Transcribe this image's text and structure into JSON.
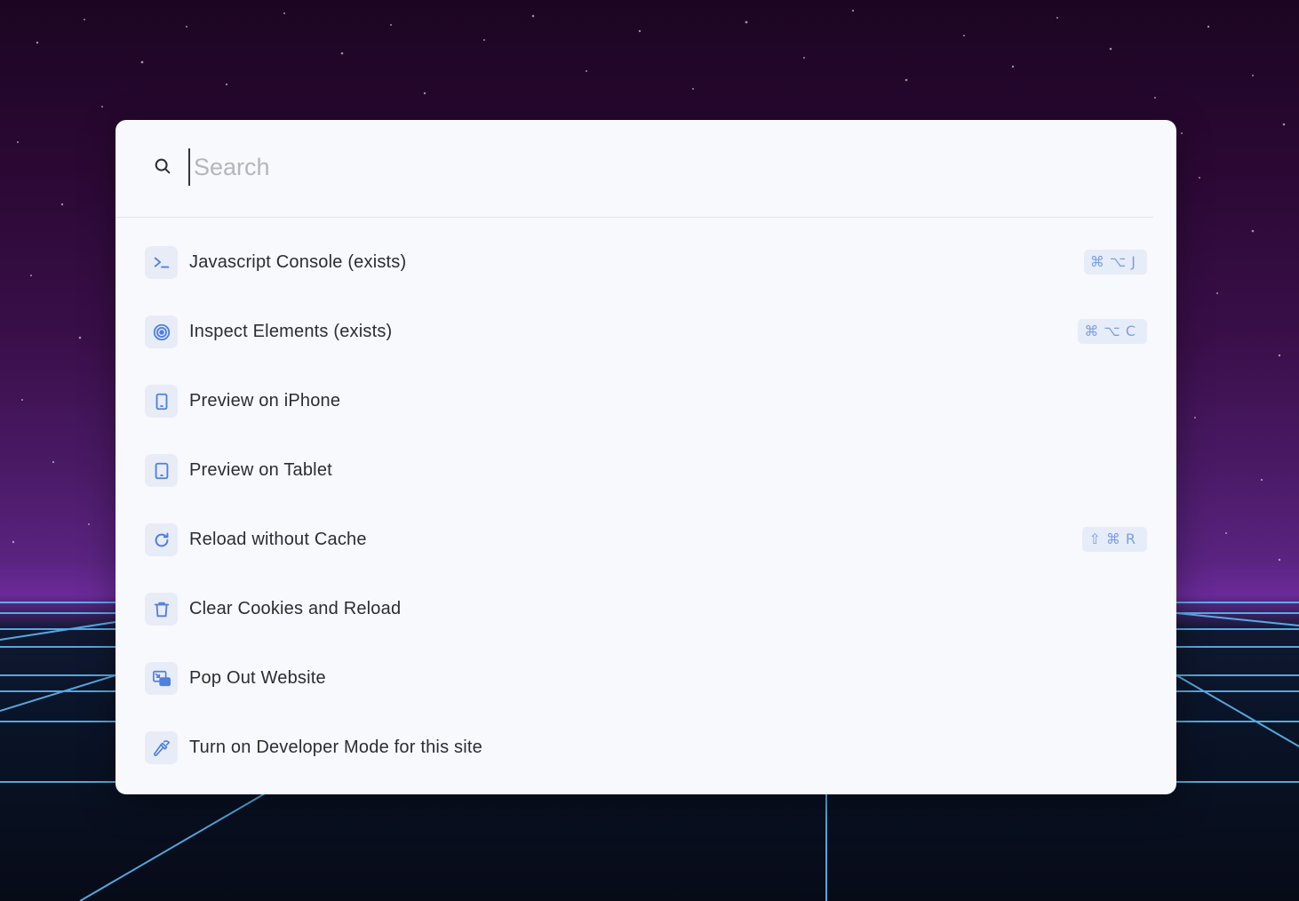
{
  "search": {
    "placeholder": "Search",
    "value": ""
  },
  "colors": {
    "accent": "#4f7fe0",
    "icon_bg": "#e7ecf7",
    "panel_bg": "#f7f9fd"
  },
  "items": [
    {
      "label": "Javascript Console (exists)",
      "icon": "terminal-icon",
      "shortcut": "⌘⌥J"
    },
    {
      "label": "Inspect Elements (exists)",
      "icon": "target-icon",
      "shortcut": "⌘⌥C"
    },
    {
      "label": "Preview on iPhone",
      "icon": "phone-icon",
      "shortcut": ""
    },
    {
      "label": "Preview on Tablet",
      "icon": "tablet-icon",
      "shortcut": ""
    },
    {
      "label": "Reload without Cache",
      "icon": "reload-icon",
      "shortcut": "⇧⌘R"
    },
    {
      "label": "Clear Cookies and Reload",
      "icon": "trash-icon",
      "shortcut": ""
    },
    {
      "label": "Pop Out Website",
      "icon": "pop-out-icon",
      "shortcut": ""
    },
    {
      "label": "Turn on Developer Mode for this site",
      "icon": "hammer-icon",
      "shortcut": ""
    }
  ]
}
